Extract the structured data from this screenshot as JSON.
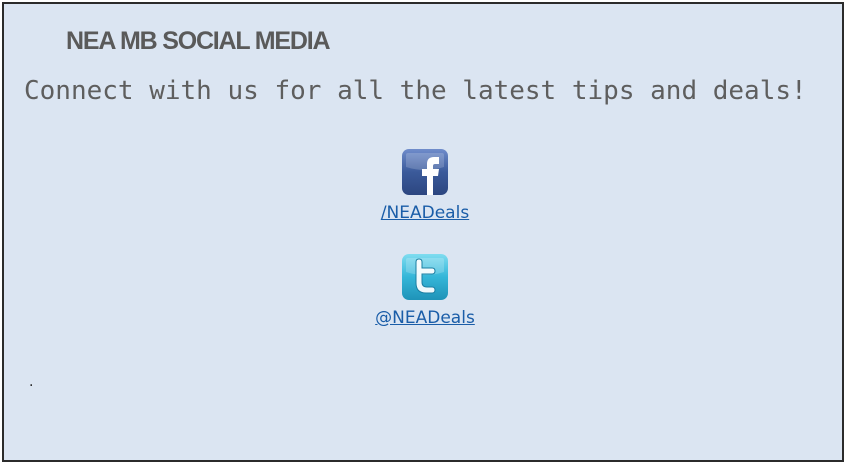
{
  "panel": {
    "title": "NEA MB SOCIAL MEDIA",
    "subtitle": "Connect with us for all the latest tips and deals!",
    "footer_mark": "."
  },
  "social": [
    {
      "network": "facebook",
      "icon": "facebook-icon",
      "label": "/NEADeals"
    },
    {
      "network": "twitter",
      "icon": "twitter-icon",
      "label": "@NEADeals"
    }
  ],
  "colors": {
    "panel_background": "#dbe5f2",
    "panel_border": "#2b2b2b",
    "title": "#5a5a5a",
    "subtitle": "#5e5e5e",
    "link": "#1a5da8",
    "facebook": "#3b5a9a",
    "twitter": "#34b6d8"
  }
}
